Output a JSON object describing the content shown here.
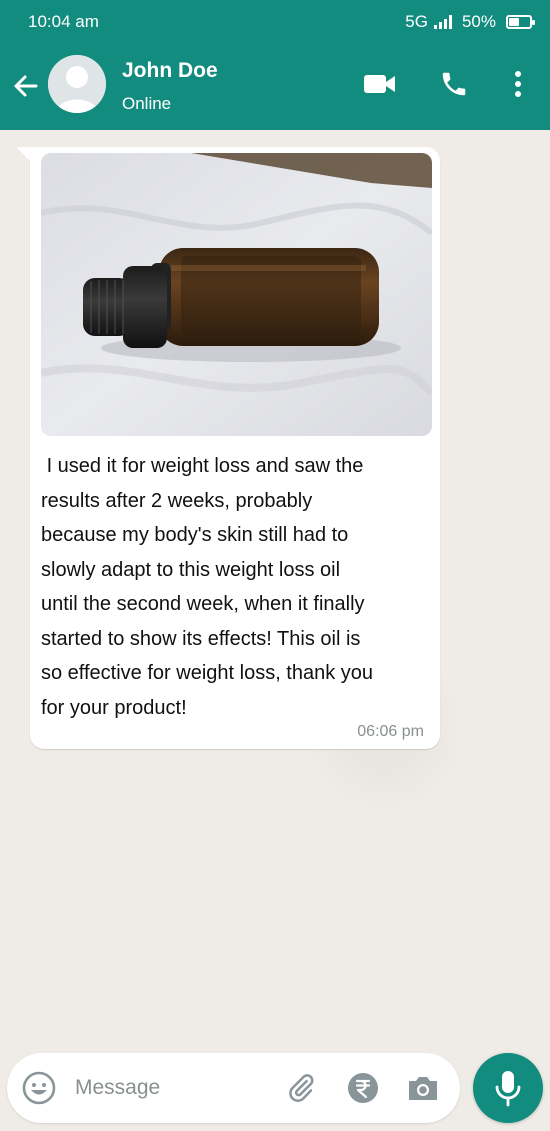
{
  "status_bar": {
    "time": "10:04 am",
    "network": "5G",
    "battery": "50%",
    "battery_level": 0.5
  },
  "header": {
    "contact_name": "John Doe",
    "contact_status": "Online",
    "icons": [
      "back-arrow-icon",
      "avatar",
      "video-call-icon",
      "phone-icon",
      "more-vertical-icon"
    ]
  },
  "message": {
    "image_desc_icon": "photo",
    "text": " I used it for weight loss and saw the\nresults after 2 weeks, probably\nbecause my body's skin still had to\nslowly adapt to this weight loss oil\nuntil the second week, when it finally\nstarted to show its effects! This oil is\nso effective for weight loss, thank you\nfor your product!",
    "time": "06:06 pm"
  },
  "composer": {
    "placeholder": "Message",
    "icons": [
      "emoji-icon",
      "attach-icon",
      "rupee-payment-icon",
      "camera-icon",
      "mic-icon"
    ]
  },
  "colors": {
    "header": "#128c7e",
    "chat_bg": "#efebe6",
    "bubble": "#ffffff",
    "mic_button": "#128c7e"
  }
}
